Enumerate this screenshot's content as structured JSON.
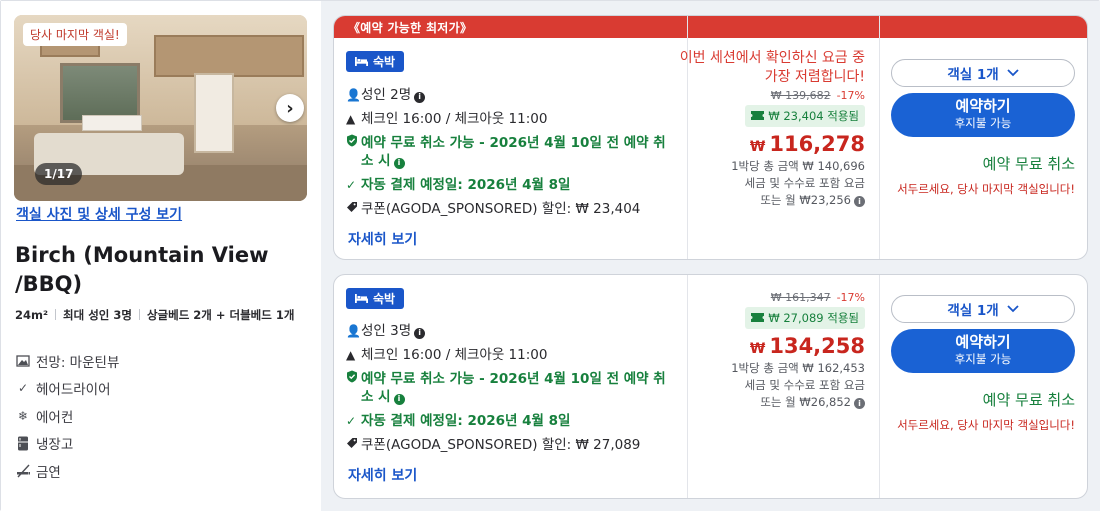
{
  "room": {
    "photo_badge": "당사 마지막 객실!",
    "photo_counter": "1/17",
    "photo_link": "객실 사진 및 상세 구성 보기",
    "name": "Birch (Mountain View /BBQ)",
    "specs": [
      "24m²",
      "최대 성인 3명",
      "상글베드 2개 + 더블베드 1개"
    ],
    "amenities": [
      {
        "icon": "mountain-view-icon",
        "label": "전망: 마운틴뷰"
      },
      {
        "icon": "check-icon",
        "label": "헤어드라이어"
      },
      {
        "icon": "snowflake-icon",
        "label": "에어컨"
      },
      {
        "icon": "fridge-icon",
        "label": "냉장고"
      },
      {
        "icon": "no-smoking-icon",
        "label": "금연"
      }
    ]
  },
  "offers": [
    {
      "ribbon": "《예약 가능한 최저가》",
      "stay_badge": "숙박",
      "adults": "성인 2명",
      "checkin": "체크인 16:00 / 체크아웃 11:00",
      "free_cancel_detail": "예약 무료 취소 가능 - 2026년 4월 10일 전 예약 취소 시",
      "auto_payment": "자동 결제 예정일: 2026년 4월 8일",
      "coupon": "쿠폰(AGODA_SPONSORED) 할인: ₩ 23,404",
      "more_link": "자세히 보기",
      "promo_text": "이번 세션에서 확인하신 요금 중 가장 저렴합니다!",
      "old_price": "₩ 139,682",
      "discount_pct": "-17%",
      "coupon_applied": "₩ 23,404 적용됨",
      "price_currency": "₩",
      "price": "116,278",
      "total_line": "1박당 총 금액 ₩ 140,696",
      "tax_line": "세금 및 수수료 포함 요금",
      "monthly_line": "또는 월 ₩23,256",
      "qty_label": "객실 1개",
      "book_label": "예약하기",
      "book_sub": "후지불 가능",
      "free_cancel": "예약 무료 취소",
      "hurry": "서두르세요, 당사 마지막 객실입니다!"
    },
    {
      "stay_badge": "숙박",
      "adults": "성인 3명",
      "checkin": "체크인 16:00 / 체크아웃 11:00",
      "free_cancel_detail": "예약 무료 취소 가능 - 2026년 4월 10일 전 예약 취소 시",
      "auto_payment": "자동 결제 예정일: 2026년 4월 8일",
      "coupon": "쿠폰(AGODA_SPONSORED) 할인: ₩ 27,089",
      "more_link": "자세히 보기",
      "old_price": "₩ 161,347",
      "discount_pct": "-17%",
      "coupon_applied": "₩ 27,089 적용됨",
      "price_currency": "₩",
      "price": "134,258",
      "total_line": "1박당 총 금액 ₩ 162,453",
      "tax_line": "세금 및 수수료 포함 요금",
      "monthly_line": "또는 월 ₩26,852",
      "qty_label": "객실 1개",
      "book_label": "예약하기",
      "book_sub": "후지불 가능",
      "free_cancel": "예약 무료 취소",
      "hurry": "서두르세요, 당사 마지막 객실입니다!"
    }
  ],
  "colors": {
    "accent_blue": "#1a62d4",
    "ribbon_red": "#d93b32",
    "price_red": "#c8261e",
    "green": "#17803d"
  }
}
